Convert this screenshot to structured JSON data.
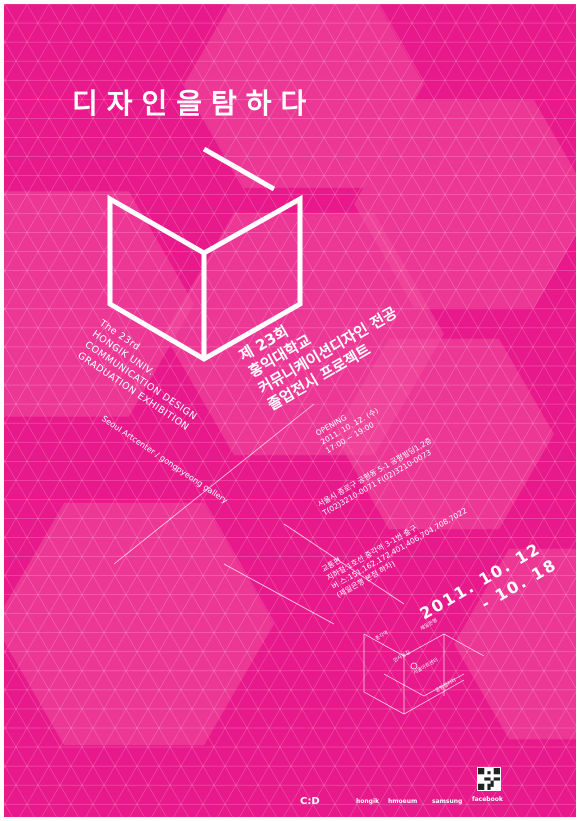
{
  "colors": {
    "background": "#e8198a",
    "light_hex": "#f0509f",
    "text": "#ffffff"
  },
  "poster": {
    "main_title": "디자인을탐하다",
    "english_lines": [
      "The 23rd",
      "HONGIK UNIV.",
      "COMMUNICATION DESIGN",
      "GRADUATION EXHIBITION"
    ],
    "venue_en": "Seoul Artcenter / gongpyeong gallery",
    "korean_title_lines": [
      "제 23회",
      "홍익대학교",
      "커뮤니케이션디자인 전공",
      "졸업전시 프로젝트"
    ],
    "opening": {
      "label": "OPENING",
      "date": "2011. 10. 12. (수)",
      "time": "17:00 ~ 19:00"
    },
    "address": {
      "line1": "서울시 종로구 공평동 5-1 공평빌딩1,2층",
      "line2": "T(02)3210-0071  F(02)3210-0073"
    },
    "directions": {
      "title": "교통편",
      "subway": "지하철:1호선 종각역 3-1번 출구",
      "bus": "버   스:151,162,172,401,406,704,708,7022",
      "note": "(제일은행 본점 하차)"
    },
    "dates": [
      "2011. 10. 12",
      "- 10. 18"
    ],
    "map_labels": [
      "종각역",
      "제일은행",
      "인사동길",
      "공평갤러리",
      "서울아트센터"
    ],
    "footer": {
      "sponsors": [
        "C:D",
        "hongik",
        "hmoeum",
        "samsung"
      ],
      "facebook": "facebook"
    },
    "icons": [
      "qr-code-icon"
    ]
  }
}
